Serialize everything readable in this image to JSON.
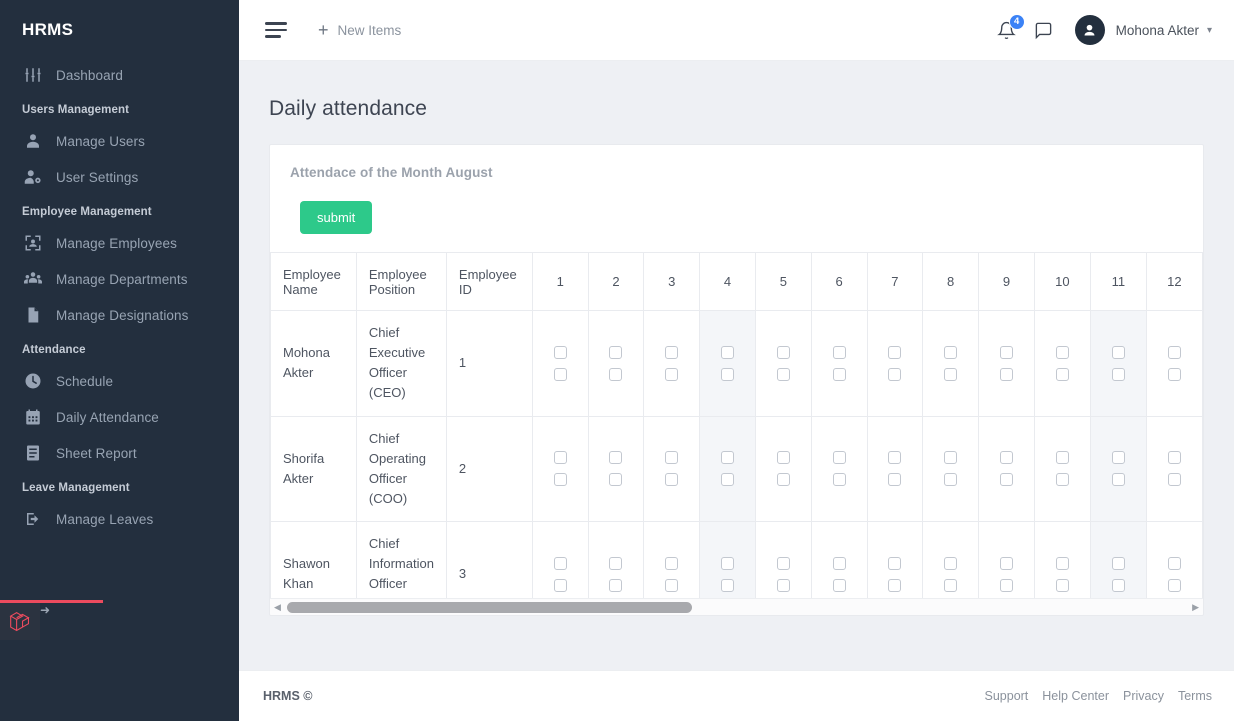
{
  "sidebar": {
    "brand": "HRMS",
    "groups": [
      {
        "label": null,
        "items": [
          {
            "label": "Dashboard",
            "icon": "sliders-icon"
          }
        ]
      },
      {
        "label": "Users Management",
        "items": [
          {
            "label": "Manage Users",
            "icon": "user-icon"
          },
          {
            "label": "User Settings",
            "icon": "user-gear-icon"
          }
        ]
      },
      {
        "label": "Employee Management",
        "items": [
          {
            "label": "Manage Employees",
            "icon": "employee-scan-icon"
          },
          {
            "label": "Manage Departments",
            "icon": "users-group-icon"
          },
          {
            "label": "Manage Designations",
            "icon": "document-icon"
          }
        ]
      },
      {
        "label": "Attendance",
        "items": [
          {
            "label": "Schedule",
            "icon": "clock-icon"
          },
          {
            "label": "Daily Attendance",
            "icon": "calendar-icon"
          },
          {
            "label": "Sheet Report",
            "icon": "list-report-icon"
          }
        ]
      },
      {
        "label": "Leave Management",
        "items": [
          {
            "label": "Manage Leaves",
            "icon": "leave-icon"
          }
        ]
      }
    ],
    "debug_badge": "laravel-logo-icon"
  },
  "topbar": {
    "menu_toggle": "hamburger-icon",
    "new_items_label": "New Items",
    "notifications_count": "4",
    "user_name": "Mohona Akter",
    "accent_badge_color": "#3b82f6"
  },
  "page": {
    "title": "Daily attendance"
  },
  "card": {
    "subtitle": "Attendace of the Month August",
    "submit_label": "submit",
    "submit_color": "#2dc98a"
  },
  "table": {
    "headers": [
      "Employee Name",
      "Employee Position",
      "Employee ID"
    ],
    "days": [
      "1",
      "2",
      "3",
      "4",
      "5",
      "6",
      "7",
      "8",
      "9",
      "10",
      "11",
      "12"
    ],
    "shaded_days": [
      "4",
      "11"
    ],
    "rows": [
      {
        "name": "Mohona Akter",
        "position": "Chief Executive Officer (CEO)",
        "id": "1"
      },
      {
        "name": "Shorifa Akter",
        "position": "Chief Operating Officer (COO)",
        "id": "2"
      },
      {
        "name": "Shawon Khan",
        "position": "Chief Information Officer (CIO)",
        "id": "3"
      }
    ],
    "checkboxes_per_cell": 2
  },
  "footer": {
    "copyright": "HRMS ©",
    "links": [
      "Support",
      "Help Center",
      "Privacy",
      "Terms"
    ]
  }
}
